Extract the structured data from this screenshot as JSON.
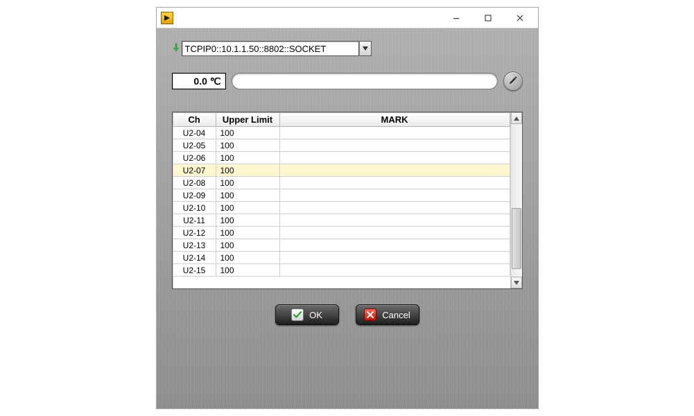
{
  "resource": {
    "value": "TCPIP0::10.1.1.50::8802::SOCKET"
  },
  "temperature": {
    "display": "0.0 ℃"
  },
  "mark_input": {
    "value": ""
  },
  "table": {
    "headers": {
      "ch": "Ch",
      "limit": "Upper Limit",
      "mark": "MARK"
    },
    "selected_index": 3,
    "rows": [
      {
        "ch": "U2-04",
        "limit": "100",
        "mark": ""
      },
      {
        "ch": "U2-05",
        "limit": "100",
        "mark": ""
      },
      {
        "ch": "U2-06",
        "limit": "100",
        "mark": ""
      },
      {
        "ch": "U2-07",
        "limit": "100",
        "mark": ""
      },
      {
        "ch": "U2-08",
        "limit": "100",
        "mark": ""
      },
      {
        "ch": "U2-09",
        "limit": "100",
        "mark": ""
      },
      {
        "ch": "U2-10",
        "limit": "100",
        "mark": ""
      },
      {
        "ch": "U2-11",
        "limit": "100",
        "mark": ""
      },
      {
        "ch": "U2-12",
        "limit": "100",
        "mark": ""
      },
      {
        "ch": "U2-13",
        "limit": "100",
        "mark": ""
      },
      {
        "ch": "U2-14",
        "limit": "100",
        "mark": ""
      },
      {
        "ch": "U2-15",
        "limit": "100",
        "mark": ""
      }
    ]
  },
  "scrollbar": {
    "thumb_top_pct": 55,
    "thumb_height_pct": 40
  },
  "buttons": {
    "ok": "OK",
    "cancel": "Cancel"
  }
}
